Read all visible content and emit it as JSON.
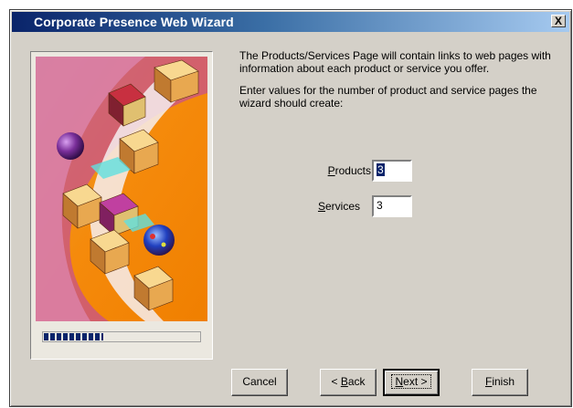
{
  "window": {
    "title": "Corporate Presence Web Wizard",
    "close_glyph": "X"
  },
  "description": {
    "para1": "The Products/Services Page will contain links to web pages with information about each product or service you offer.",
    "para2": "Enter values for the number of product and service pages the wizard should create:"
  },
  "fields": {
    "products": {
      "label_accel": "P",
      "label_rest": "roducts",
      "value": "3"
    },
    "services": {
      "label_accel": "S",
      "label_rest": "ervices",
      "value": "3"
    }
  },
  "progress": {
    "fraction": 0.38
  },
  "buttons": {
    "cancel": "Cancel",
    "back_prefix": "< ",
    "back_accel": "B",
    "back_rest": "ack",
    "next_accel": "N",
    "next_rest": "ext >",
    "finish_accel": "F",
    "finish_rest": "inish"
  },
  "colors": {
    "titlebar_start": "#0a246a",
    "titlebar_end": "#a6caf0",
    "face": "#d4d0c8",
    "art_orange": "#f58a0b",
    "art_purple": "#7a2f9a"
  },
  "icons": {
    "artwork": "boxes-and-spheres-illustration",
    "close": "close-icon"
  }
}
